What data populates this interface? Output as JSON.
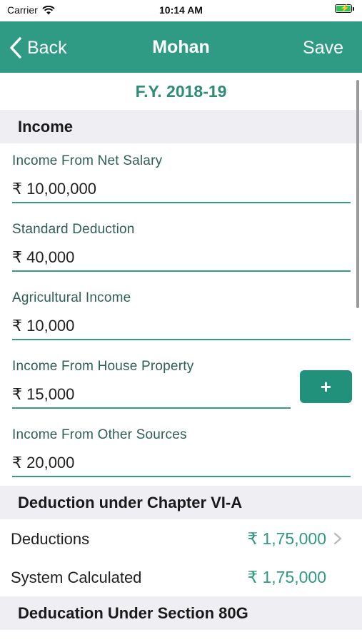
{
  "status_bar": {
    "carrier": "Carrier",
    "time": "10:14 AM"
  },
  "nav": {
    "back_label": "Back",
    "title": "Mohan",
    "save_label": "Save"
  },
  "fy_label": "F.Y. 2018-19",
  "income": {
    "header": "Income",
    "fields": [
      {
        "label": "Income From Net Salary",
        "value": "₹ 10,00,000"
      },
      {
        "label": "Standard Deduction",
        "value": "₹ 40,000"
      },
      {
        "label": "Agricultural Income",
        "value": "₹ 10,000"
      },
      {
        "label": "Income From House Property",
        "value": "₹ 15,000",
        "add_label": "+"
      },
      {
        "label": "Income From Other Sources",
        "value": "₹ 20,000"
      }
    ]
  },
  "deduction_via": {
    "header": "Deduction under Chapter VI-A",
    "rows": [
      {
        "label": "Deductions",
        "value": "₹ 1,75,000"
      },
      {
        "label": "System Calculated",
        "value": "₹ 1,75,000"
      }
    ]
  },
  "section_80g": {
    "header": "Deducation Under Section 80G"
  },
  "colors": {
    "accent": "#2f9b85",
    "header_bg": "#efeff3"
  }
}
